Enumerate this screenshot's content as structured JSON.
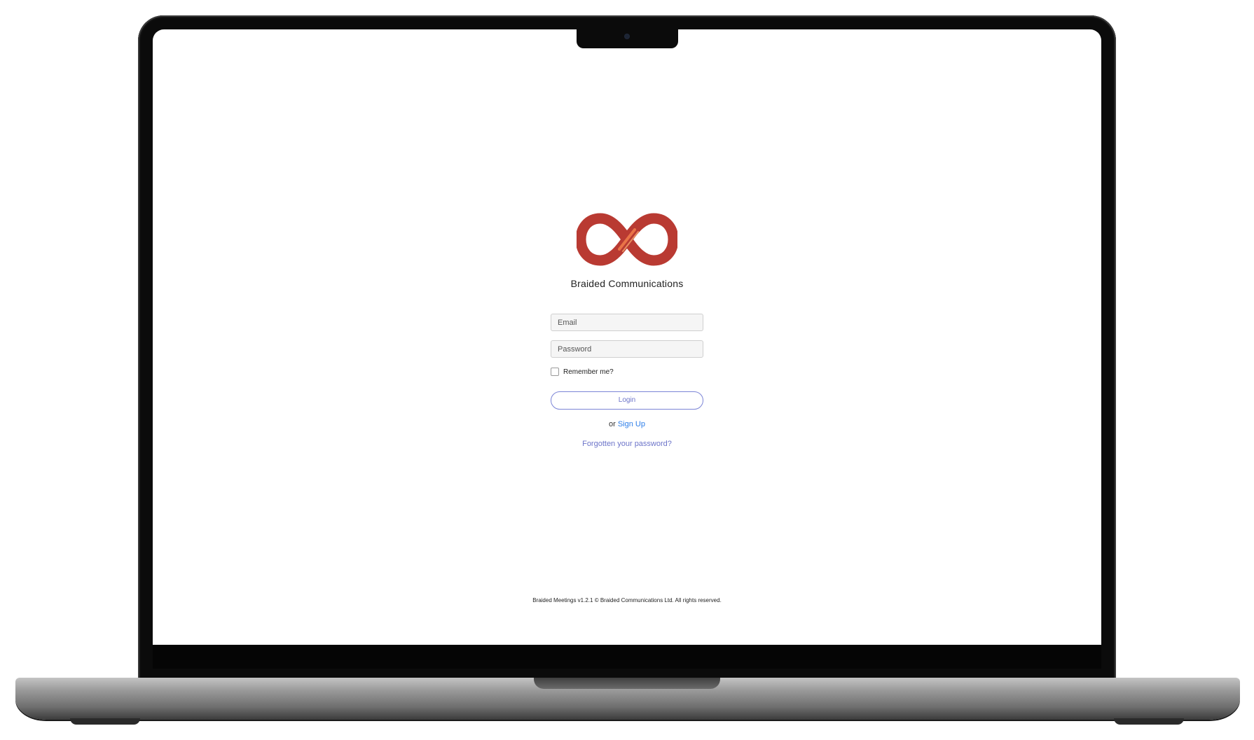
{
  "brand": {
    "name": "Braided Communications",
    "logo_icon": "infinity-logo",
    "logo_color": "#b93a32",
    "logo_accent": "#ef7a4a"
  },
  "login_form": {
    "email_placeholder": "Email",
    "password_placeholder": "Password",
    "remember_label": "Remember me?",
    "login_label": "Login",
    "signup_prefix": "or",
    "signup_label": "Sign Up",
    "forgot_label": "Forgotten your password?"
  },
  "footer": {
    "text": "Braided Meetings v1.2.1 © Braided Communications Ltd. All rights reserved."
  },
  "colors": {
    "accent": "#6c74c9",
    "link": "#2b7de9"
  }
}
